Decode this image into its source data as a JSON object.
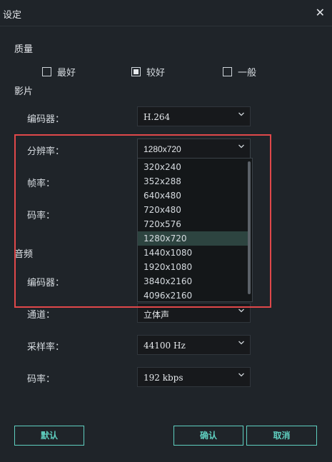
{
  "window": {
    "title": "设定"
  },
  "quality": {
    "heading": "质量",
    "options": [
      {
        "label": "最好",
        "checked": false
      },
      {
        "label": "较好",
        "checked": true
      },
      {
        "label": "一般",
        "checked": false
      }
    ]
  },
  "video": {
    "heading": "影片",
    "encoder_label": "编码器：",
    "encoder_value": "H.264",
    "resolution_label": "分辨率：",
    "resolution_value": "1280x720",
    "framerate_label": "帧率：",
    "bitrate_label": "码率：",
    "resolution_options": [
      "320x240",
      "352x288",
      "640x480",
      "720x480",
      "720x576",
      "1280x720",
      "1440x1080",
      "1920x1080",
      "3840x2160",
      "4096x2160"
    ],
    "selected_index": 5
  },
  "audio": {
    "heading": "音频",
    "encoder_label": "编码器：",
    "channel_label": "通道：",
    "channel_value": "立体声",
    "samplerate_label": "采样率：",
    "samplerate_value": "44100 Hz",
    "bitrate_label": "码率：",
    "bitrate_value": "192 kbps"
  },
  "buttons": {
    "default": "默认",
    "ok": "确认",
    "cancel": "取消"
  },
  "colors": {
    "accent": "#5fcfc0",
    "highlight_box": "#e0484a",
    "background": "#1f2429"
  }
}
